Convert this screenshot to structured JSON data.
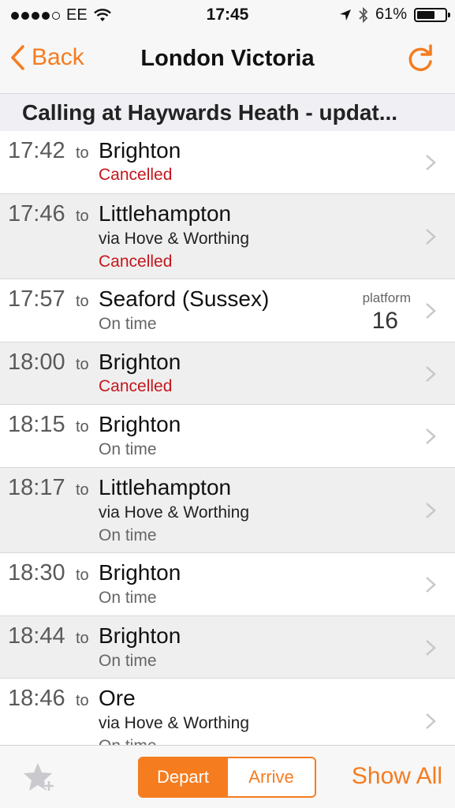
{
  "status_bar": {
    "carrier": "EE",
    "time": "17:45",
    "battery": "61%"
  },
  "nav": {
    "back_label": "Back",
    "title": "London Victoria"
  },
  "section": {
    "title": "Calling at Haywards Heath - updat..."
  },
  "rows": [
    {
      "time": "17:42",
      "to": "to",
      "destination": "Brighton",
      "via": "",
      "status": "Cancelled",
      "platform_label": "",
      "platform": ""
    },
    {
      "time": "17:46",
      "to": "to",
      "destination": "Littlehampton",
      "via": "via Hove & Worthing",
      "status": "Cancelled",
      "platform_label": "",
      "platform": ""
    },
    {
      "time": "17:57",
      "to": "to",
      "destination": "Seaford (Sussex)",
      "via": "",
      "status": "On time",
      "platform_label": "platform",
      "platform": "16"
    },
    {
      "time": "18:00",
      "to": "to",
      "destination": "Brighton",
      "via": "",
      "status": "Cancelled",
      "platform_label": "",
      "platform": ""
    },
    {
      "time": "18:15",
      "to": "to",
      "destination": "Brighton",
      "via": "",
      "status": "On time",
      "platform_label": "",
      "platform": ""
    },
    {
      "time": "18:17",
      "to": "to",
      "destination": "Littlehampton",
      "via": "via Hove & Worthing",
      "status": "On time",
      "platform_label": "",
      "platform": ""
    },
    {
      "time": "18:30",
      "to": "to",
      "destination": "Brighton",
      "via": "",
      "status": "On time",
      "platform_label": "",
      "platform": ""
    },
    {
      "time": "18:44",
      "to": "to",
      "destination": "Brighton",
      "via": "",
      "status": "On time",
      "platform_label": "",
      "platform": ""
    },
    {
      "time": "18:46",
      "to": "to",
      "destination": "Ore",
      "via": "via Hove & Worthing",
      "status": "On time",
      "platform_label": "",
      "platform": ""
    }
  ],
  "toolbar": {
    "depart_label": "Depart",
    "arrive_label": "Arrive",
    "show_all_label": "Show All"
  },
  "colors": {
    "accent": "#f57c1f",
    "cancelled": "#c4161c",
    "ontime": "#666666"
  }
}
